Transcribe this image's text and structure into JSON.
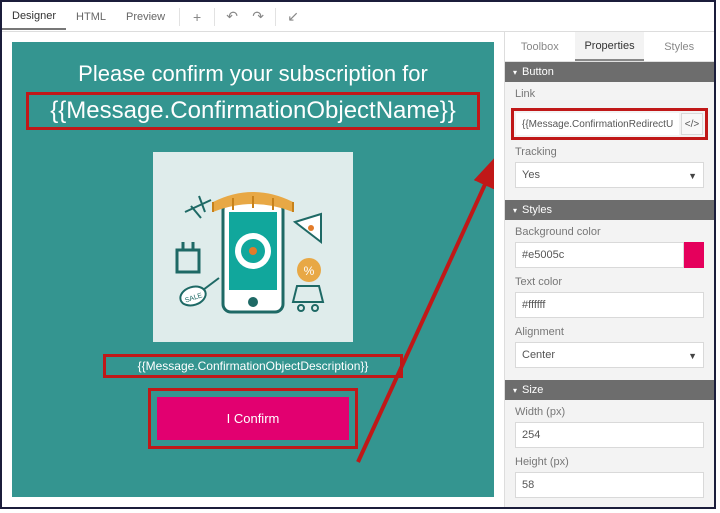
{
  "topbar": {
    "tabs": {
      "designer": "Designer",
      "html": "HTML",
      "preview": "Preview"
    }
  },
  "canvas": {
    "headline": "Please confirm your subscription for",
    "object_name": "{{Message.ConfirmationObjectName}}",
    "description": "{{Message.ConfirmationObjectDescription}}",
    "confirm_label": "I Confirm"
  },
  "panel": {
    "tabs": {
      "toolbox": "Toolbox",
      "properties": "Properties",
      "styles": "Styles"
    },
    "button": {
      "title": "Button",
      "link_label": "Link",
      "link_value": "{{Message.ConfirmationRedirectURL}}",
      "tracking_label": "Tracking",
      "tracking_value": "Yes"
    },
    "styles": {
      "title": "Styles",
      "bg_label": "Background color",
      "bg_value": "#e5005c",
      "text_label": "Text color",
      "text_value": "#ffffff",
      "align_label": "Alignment",
      "align_value": "Center"
    },
    "size": {
      "title": "Size",
      "width_label": "Width (px)",
      "width_value": "254",
      "height_label": "Height (px)",
      "height_value": "58"
    }
  }
}
